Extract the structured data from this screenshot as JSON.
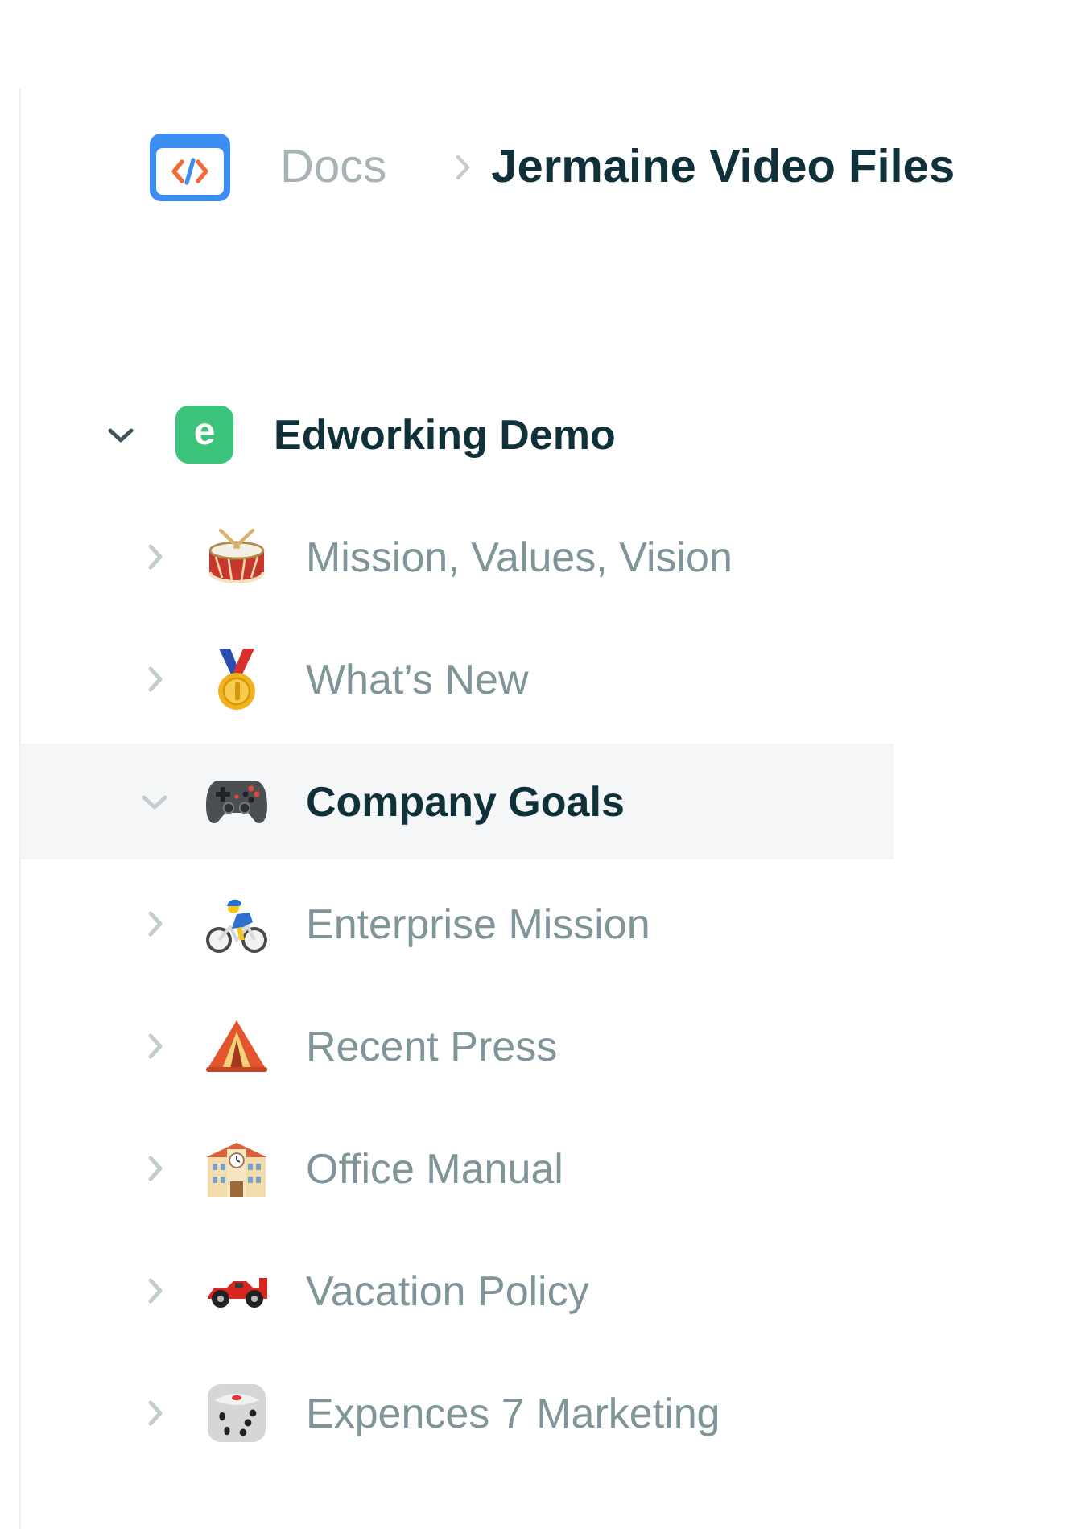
{
  "breadcrumb": [
    {
      "label": "Docs",
      "current": false
    },
    {
      "label": "Jermaine Video Files",
      "current": true
    }
  ],
  "tree": [
    {
      "logo_letter": "e",
      "label": "Edworking Demo",
      "expanded": true,
      "children": [
        {
          "label": "Mission, Values, Vision",
          "expanded": false,
          "selected": false
        },
        {
          "label": "What’s New",
          "expanded": false,
          "selected": false
        },
        {
          "label": "Company Goals",
          "expanded": true,
          "selected": true
        },
        {
          "label": "Enterprise Mission",
          "expanded": false,
          "selected": false
        },
        {
          "label": "Recent Press",
          "expanded": false,
          "selected": false
        },
        {
          "label": "Office Manual",
          "expanded": false,
          "selected": false
        },
        {
          "label": "Vacation Policy",
          "expanded": false,
          "selected": false
        },
        {
          "label": "Expences 7 Marketing",
          "expanded": false,
          "selected": false
        }
      ]
    }
  ]
}
